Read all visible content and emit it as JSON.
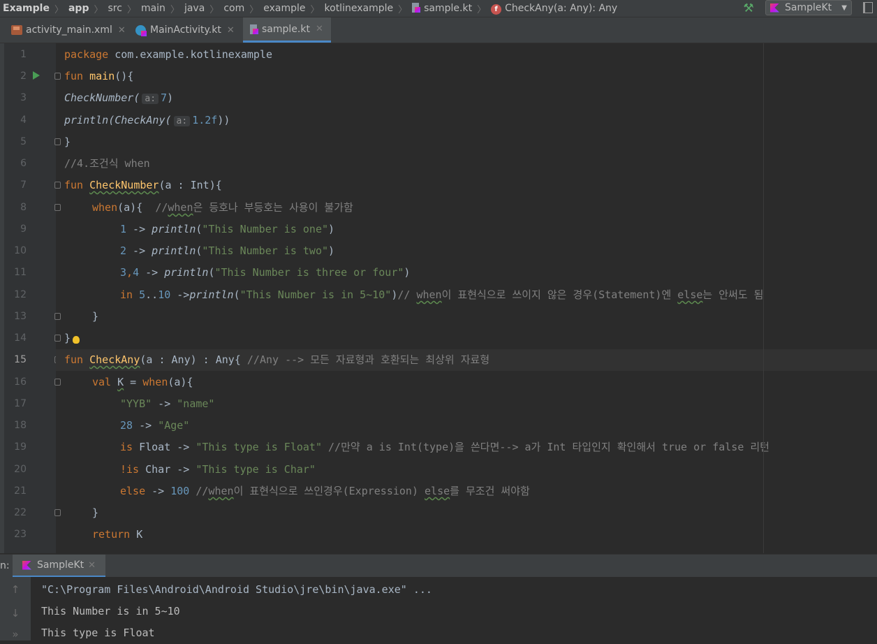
{
  "nav": {
    "crumbs": [
      "Example",
      "app",
      "src",
      "main",
      "java",
      "com",
      "example",
      "kotlinexample",
      "sample.kt",
      "CheckAny(a: Any): Any"
    ],
    "run_config": "SampleKt"
  },
  "tabs": [
    {
      "label": "activity_main.xml",
      "icon": "xml-file-icon"
    },
    {
      "label": "MainActivity.kt",
      "icon": "kotlin-class-icon"
    },
    {
      "label": "sample.kt",
      "icon": "kotlin-file-icon",
      "active": true
    }
  ],
  "editor": {
    "current_line": 15,
    "line_numbers": [
      "1",
      "2",
      "3",
      "4",
      "5",
      "6",
      "7",
      "8",
      "9",
      "10",
      "11",
      "12",
      "13",
      "14",
      "15",
      "16",
      "17",
      "18",
      "19",
      "20",
      "21",
      "22",
      "23"
    ],
    "code": {
      "l1_pkg": "package",
      "l1_rest": " com.example.kotlinexample",
      "l2_fun": "fun",
      "l2_name": " main",
      "l2_rest": "(){",
      "l3_call": "CheckNumber(",
      "l3_hint": "a:",
      "l3_num": "7",
      "l3_end": ")",
      "l4_println": "println(",
      "l4_call": "CheckAny(",
      "l4_hint": "a:",
      "l4_num": "1.2f",
      "l4_end": "))",
      "l5": "}",
      "l6": "//4.조건식 when",
      "l7_fun": "fun ",
      "l7_name": "CheckNumber",
      "l7_rest": "(a : Int){",
      "l8_when": "when",
      "l8_rest": "(a){  ",
      "l8_c1": "//",
      "l8_c2": "when",
      "l8_c3": "은 등호나 부등호는 사용이 불가함",
      "l9_num": "1",
      "l9_arrow": " -> ",
      "l9_fn": "println",
      "l9_p1": "(",
      "l9_str": "\"This Number is one\"",
      "l9_p2": ")",
      "l10_num": "2",
      "l10_arrow": " -> ",
      "l10_fn": "println",
      "l10_p1": "(",
      "l10_str": "\"This Number is two\"",
      "l10_p2": ")",
      "l11_num1": "3",
      "l11_comma": ",",
      "l11_num2": "4",
      "l11_arrow": " -> ",
      "l11_fn": "println",
      "l11_p1": "(",
      "l11_str": "\"This Number is three or four\"",
      "l11_p2": ")",
      "l12_in": "in",
      "l12_sp": " ",
      "l12_n1": "5",
      "l12_dots": "..",
      "l12_n2": "10",
      "l12_arrow": " ->",
      "l12_fn": "println",
      "l12_p1": "(",
      "l12_str": "\"This Number is in 5~10\"",
      "l12_p2": ")",
      "l12_c1": "// ",
      "l12_c2": "when",
      "l12_c3": "이 표현식으로 쓰이지 않은 경우(Statement)엔 ",
      "l12_c4": "else",
      "l12_c5": "는 안써도 됨",
      "l13": "}",
      "l14": "}",
      "l15_fun": "fun ",
      "l15_name": "CheckAny",
      "l15_rest": "(a : Any) : Any{ ",
      "l15_cmt": "//Any --> 모든 자료형과 호환되는 최상위 자료형",
      "l16_val": "val ",
      "l16_k": "K",
      "l16_eq": " = ",
      "l16_when": "when",
      "l16_rest": "(a){",
      "l17_s1": "\"YYB\"",
      "l17_arrow": " -> ",
      "l17_s2": "\"name\"",
      "l18_num": "28",
      "l18_arrow": " -> ",
      "l18_str": "\"Age\"",
      "l19_is": "is",
      "l19_type": " Float -> ",
      "l19_str": "\"This type is Float\"",
      "l19_cmt": " //만약 a is Int(type)을 쓴다면--> a가 Int 타입인지 확인해서 true or false 리턴",
      "l20_is": "!is",
      "l20_type": " Char -> ",
      "l20_str": "\"This type is Char\"",
      "l21_else": "else",
      "l21_arrow": " -> ",
      "l21_num": "100",
      "l21_c1": " //",
      "l21_c2": "when",
      "l21_c3": "이 표현식으로 쓰인경우(Expression) ",
      "l21_c4": "else",
      "l21_c5": "를 무조건 써야함",
      "l22": "}",
      "l23_ret": "return",
      "l23_rest": " K"
    }
  },
  "run_panel": {
    "label": "n:",
    "tab": "SampleKt",
    "output": [
      "\"C:\\Program Files\\Android\\Android Studio\\jre\\bin\\java.exe\" ...",
      "This Number is in 5~10",
      "This type is Float"
    ]
  },
  "colors": {
    "keyword": "#cc7832",
    "function_decl": "#ffc66d",
    "number": "#6897bb",
    "string": "#6a8759",
    "comment": "#808080",
    "accent": "#4a88c7"
  }
}
